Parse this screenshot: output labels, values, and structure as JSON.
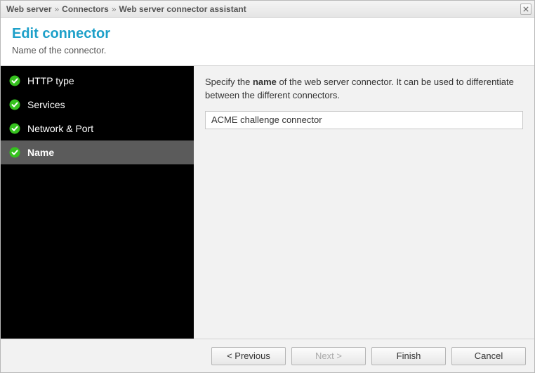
{
  "breadcrumb": {
    "item1": "Web server",
    "sep": "»",
    "item2": "Connectors",
    "item3": "Web server connector assistant"
  },
  "header": {
    "title": "Edit connector",
    "subtitle": "Name of the connector."
  },
  "steps": [
    {
      "label": "HTTP type",
      "selected": false
    },
    {
      "label": "Services",
      "selected": false
    },
    {
      "label": "Network & Port",
      "selected": false
    },
    {
      "label": "Name",
      "selected": true
    }
  ],
  "content": {
    "instruction_pre": "Specify the ",
    "instruction_bold": "name",
    "instruction_post": " of the web server connector. It can be used to differentiate between the different connectors.",
    "name_value": "ACME challenge connector"
  },
  "footer": {
    "previous": "< Previous",
    "next": "Next >",
    "finish": "Finish",
    "cancel": "Cancel"
  }
}
